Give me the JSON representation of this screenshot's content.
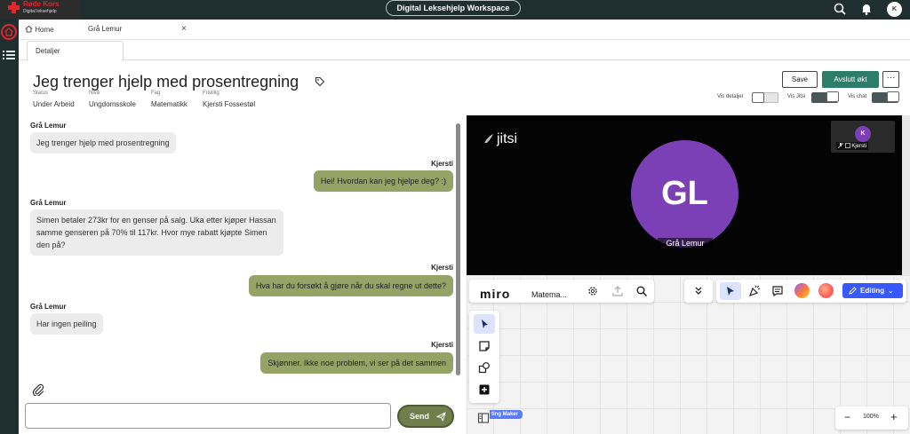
{
  "topbar": {
    "logo_name": "Røde Kors",
    "logo_sub": "Digital leksehjelp",
    "workspace": "Digital Leksehjelp Workspace",
    "user_initials": "K"
  },
  "tabs": {
    "home": "Home",
    "record": "Grå Lemur",
    "close": "×",
    "subtab": "Detaljer"
  },
  "header": {
    "title": "Jeg trenger hjelp med prosentregning",
    "fields": [
      {
        "label": "Status",
        "value": "Under Arbeid"
      },
      {
        "label": "Nivå",
        "value": "Ungdomsskole"
      },
      {
        "label": "Fag",
        "value": "Matematikk"
      },
      {
        "label": "Frivillig",
        "value": "Kjersti Fossestøl"
      }
    ],
    "save": "Save",
    "end": "Avslutt økt",
    "more": "···",
    "toggles": [
      {
        "label": "Vis detaljer",
        "on": false
      },
      {
        "label": "Vis Jitsi",
        "on": true
      },
      {
        "label": "Vis chat",
        "on": true
      }
    ]
  },
  "chat": {
    "messages": [
      {
        "sender": "Grå Lemur",
        "text": "Jeg trenger hjelp med prosentregning",
        "side": "in"
      },
      {
        "sender": "Kjersti",
        "text": "Hei! Hvordan kan jeg hjelpe deg? :)",
        "side": "out"
      },
      {
        "sender": "Grå Lemur",
        "text": "Simen betaler 273kr for en genser på salg. Uka etter kjøper Hassan samme genseren på 70% til 117kr. Hvor mye rabatt kjøpte Simen den på?",
        "side": "in"
      },
      {
        "sender": "Kjersti",
        "text": "Hva har du forsøkt å gjøre når du skal regne ut dette?",
        "side": "out"
      },
      {
        "sender": "Grå Lemur",
        "text": "Har ingen peiling",
        "side": "in"
      },
      {
        "sender": "Kjersti",
        "text": "Skjønner. Ikke noe problem, vi ser på det sammen",
        "side": "out"
      }
    ],
    "input_value": "",
    "send": "Send"
  },
  "jitsi": {
    "logo": "jitsi",
    "main_initials": "GL",
    "main_name": "Grå Lemur",
    "thumb_initials": "K",
    "thumb_name": "Kjersti"
  },
  "miro": {
    "logo": "miro",
    "board": "Matema...",
    "editing": "Editing",
    "maker_tag": "ting Maker",
    "zoom": "100%",
    "zoom_minus": "−",
    "zoom_plus": "+",
    "accent": "#3859ff"
  },
  "colors": {
    "topbar": "#1f2e2e",
    "primary_button": "#2e7d6b",
    "outgoing_bubble": "#95a366",
    "incoming_bubble": "#ececec",
    "avatar": "#7b3fb6"
  }
}
